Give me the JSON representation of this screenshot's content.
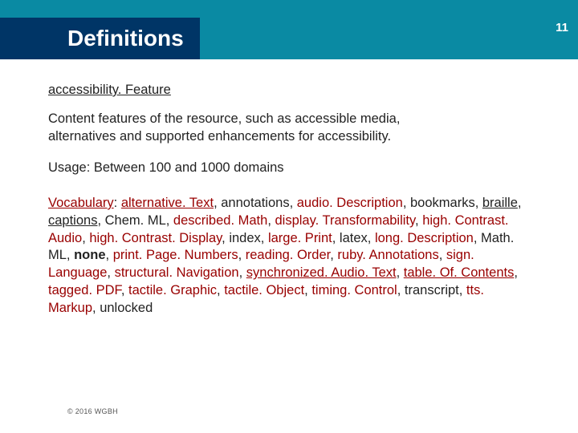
{
  "header": {
    "title": "Definitions",
    "slide_number": "11"
  },
  "term": "accessibility. Feature",
  "description_1": "Content features of the resource, such as accessible media,",
  "description_2": "alternatives and supported enhancements for accessibility.",
  "usage": "Usage: Between 100 and 1000 domains",
  "vocab_label": "Vocabulary",
  "vocab_sep": ": ",
  "vocab": {
    "alt_text": "alternative. Text",
    "annotations": ", annotations, ",
    "audio_desc": "audio. Description",
    "bookmarks": ", bookmarks, ",
    "braille": "braille",
    "captions": "captions",
    "chemml": ", Chem. ML, ",
    "descmath": "described. Math",
    "disptrans": "display. Transformability",
    "hcaudio": "high. Contrast. Audio",
    "hcdisplay": "high. Contrast. Display",
    "index": ", index, ",
    "largeprint": "large. Print",
    "latex": ", latex, ",
    "longdesc": "long. Description",
    "mathml": ", Math. ML, ",
    "none": "none",
    "ppn": "print. Page. Numbers",
    "rorder": "reading. Order",
    "rubyann": "ruby. Annotations",
    "signlang": "sign. Language",
    "structnav": "structural. Navigation",
    "syncaudio": "synchronized. Audio. Text",
    "toc": "table. Of. Contents",
    "tagpdf": "tagged. PDF",
    "tacgraphic": "tactile. Graphic",
    "tacobj": "tactile. Object",
    "timing": "timing. Control",
    "transcript": ", transcript, ",
    "tts": "tts. Markup",
    "unlocked": ", unlocked"
  },
  "copyright": "© 2016 WGBH"
}
